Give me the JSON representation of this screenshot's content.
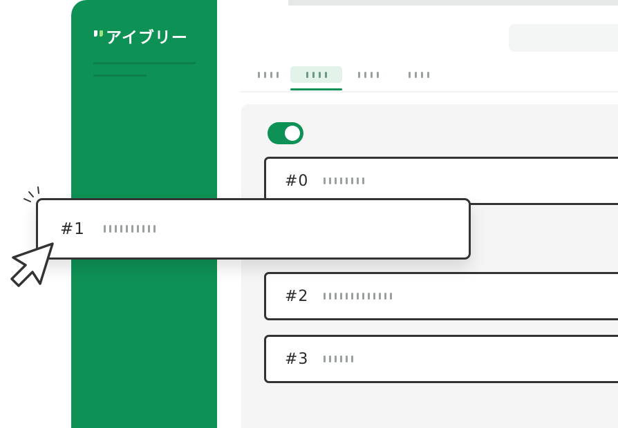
{
  "brand": {
    "name": "アイブリー"
  },
  "tabs": [
    {
      "dot_count": 4,
      "active": false
    },
    {
      "dot_count": 4,
      "active": true
    },
    {
      "dot_count": 4,
      "active": false
    },
    {
      "dot_count": 4,
      "active": false
    }
  ],
  "toggle": {
    "on": true
  },
  "rows": [
    {
      "label": "#0",
      "dot_count": 8
    },
    {
      "label": "#1",
      "dot_count": 10,
      "dragging": true
    },
    {
      "label": "#2",
      "dot_count": 13
    },
    {
      "label": "#3",
      "dot_count": 6
    }
  ],
  "colors": {
    "brand": "#0e9155",
    "accent": "#9be27c",
    "outline": "#333333"
  },
  "icons": {
    "cursor": "pointer-cursor-icon",
    "sparkle": "click-sparkle-icon"
  }
}
